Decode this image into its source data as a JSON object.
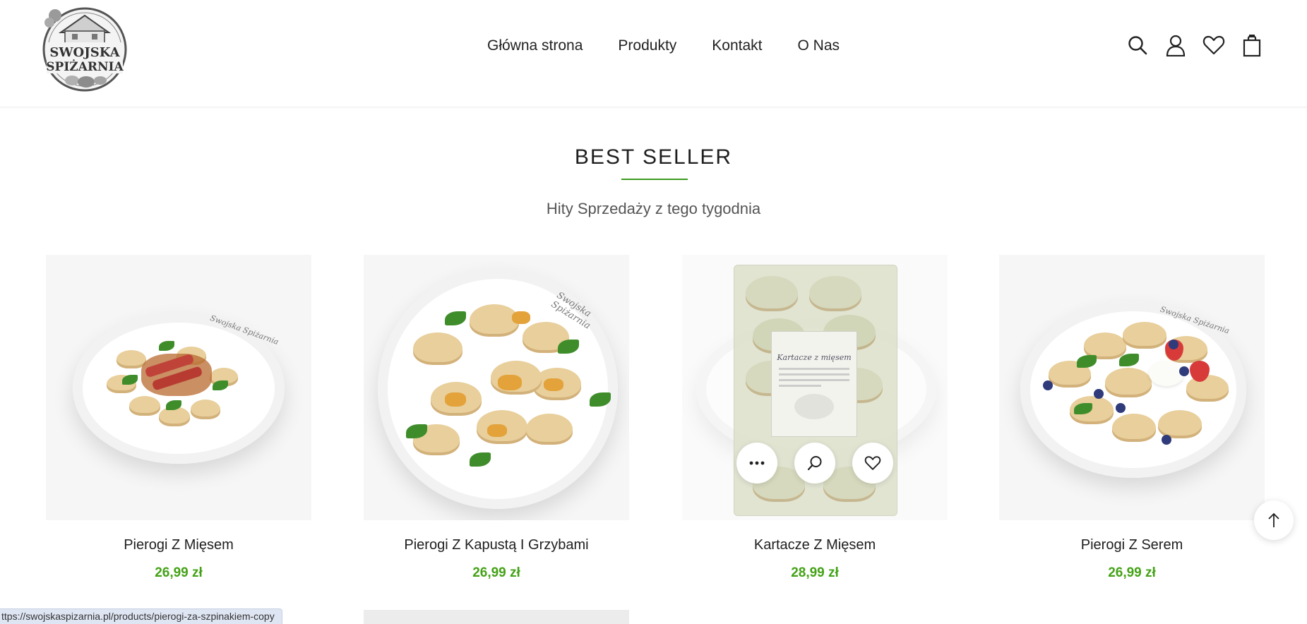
{
  "logo": {
    "line1": "SWOJSKA",
    "line2": "SPIŻARNIA"
  },
  "nav": {
    "items": [
      {
        "label": "Główna strona"
      },
      {
        "label": "Produkty"
      },
      {
        "label": "Kontakt"
      },
      {
        "label": "O Nas"
      }
    ]
  },
  "header_icons": [
    "search-icon",
    "account-icon",
    "wishlist-icon",
    "cart-icon"
  ],
  "section": {
    "title": "BEST SELLER",
    "subtitle": "Hity Sprzedaży z tego tygodnia"
  },
  "products": [
    {
      "name": "Pierogi Z Mięsem",
      "price": "26,99 zł",
      "brand_mark": "Swojska Spiżarnia"
    },
    {
      "name": "Pierogi Z Kapustą I Grzybami",
      "price": "26,99 zł",
      "brand_mark": "Swojska Spiżarnia"
    },
    {
      "name": "Kartacze Z Mięsem",
      "price": "28,99 zł",
      "package_label": "Kartacze z mięsem"
    },
    {
      "name": "Pierogi Z Serem",
      "price": "26,99 zł",
      "brand_mark": "Swojska Spiżarnia"
    }
  ],
  "hover_actions": [
    "more-options-icon",
    "quick-view-icon",
    "wishlist-icon"
  ],
  "status_bar": {
    "url": "ttps://swojskaspizarnia.pl/products/pierogi-za-szpinakiem-copy"
  },
  "colors": {
    "accent": "#44a217",
    "underline": "#3d9a1f"
  }
}
